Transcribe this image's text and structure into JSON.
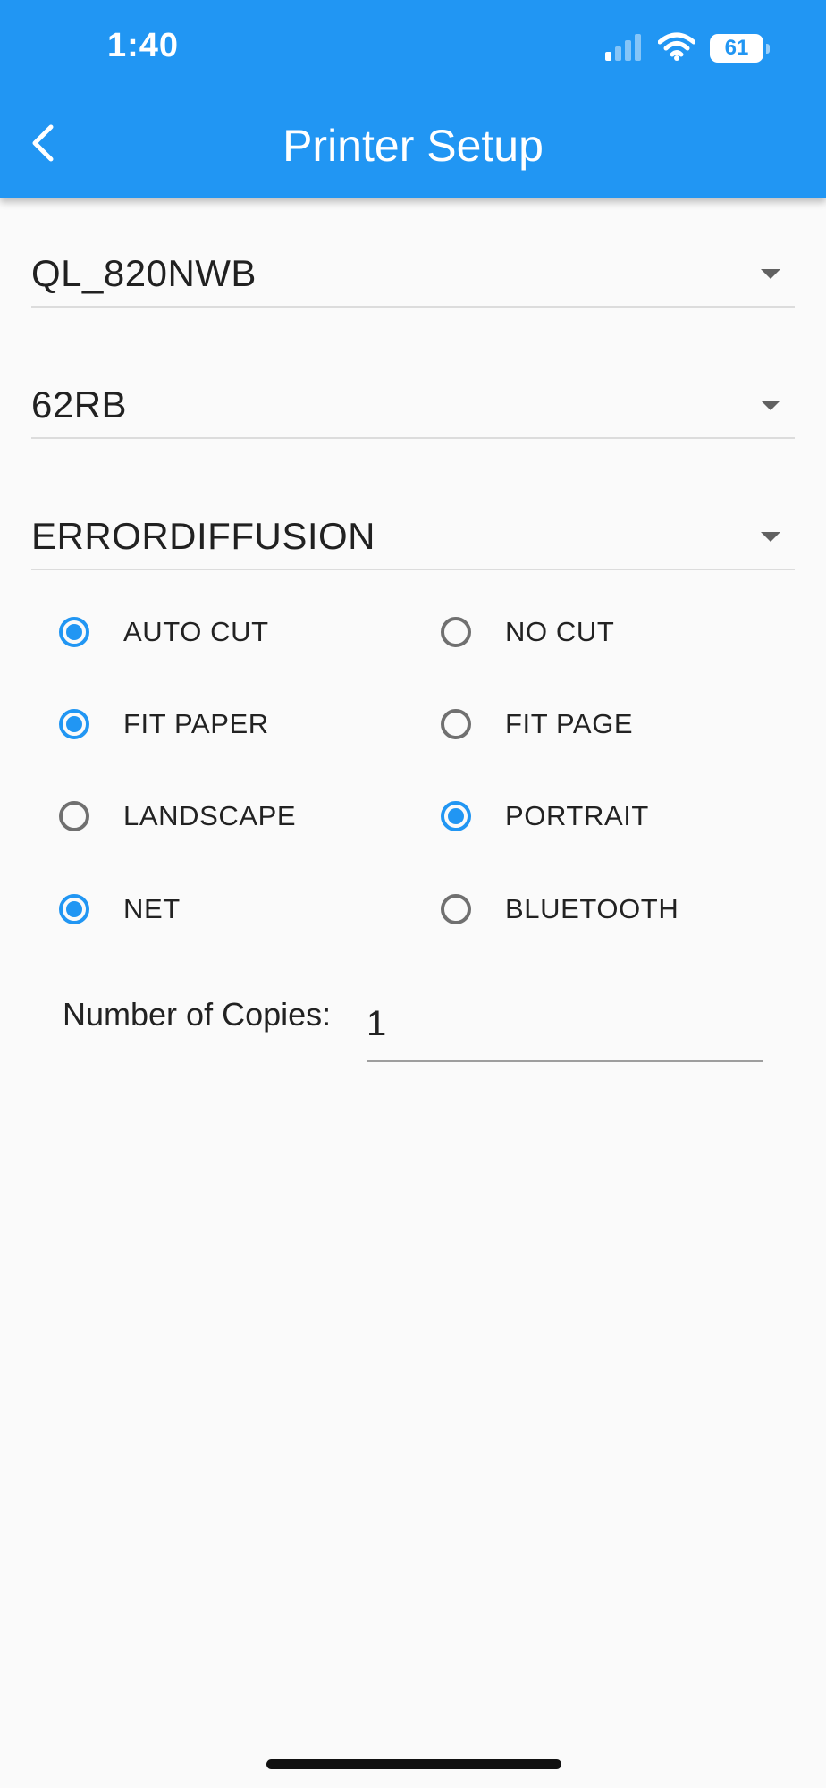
{
  "colors": {
    "primary": "#2196f3",
    "background": "#fafafa",
    "radio_unselected": "#707070"
  },
  "status_bar": {
    "time": "1:40",
    "battery": "61",
    "icons": [
      "cellular-signal-icon",
      "wifi-icon",
      "battery-icon"
    ]
  },
  "app_bar": {
    "title": "Printer Setup",
    "back_icon": "chevron-left-icon"
  },
  "dropdowns": {
    "printer_model": "QL_820NWB",
    "label_size": "62RB",
    "halftone": "ERRORDIFFUSION"
  },
  "radio_groups": [
    {
      "name": "cut",
      "options": [
        {
          "label": "AUTO CUT",
          "selected": true
        },
        {
          "label": "NO CUT",
          "selected": false
        }
      ]
    },
    {
      "name": "fit",
      "options": [
        {
          "label": "FIT PAPER",
          "selected": true
        },
        {
          "label": "FIT PAGE",
          "selected": false
        }
      ]
    },
    {
      "name": "orientation",
      "options": [
        {
          "label": "LANDSCAPE",
          "selected": false
        },
        {
          "label": "PORTRAIT",
          "selected": true
        }
      ]
    },
    {
      "name": "connection",
      "options": [
        {
          "label": "NET",
          "selected": true
        },
        {
          "label": "BLUETOOTH",
          "selected": false
        }
      ]
    }
  ],
  "copies": {
    "label": "Number of Copies:",
    "value": "1"
  }
}
